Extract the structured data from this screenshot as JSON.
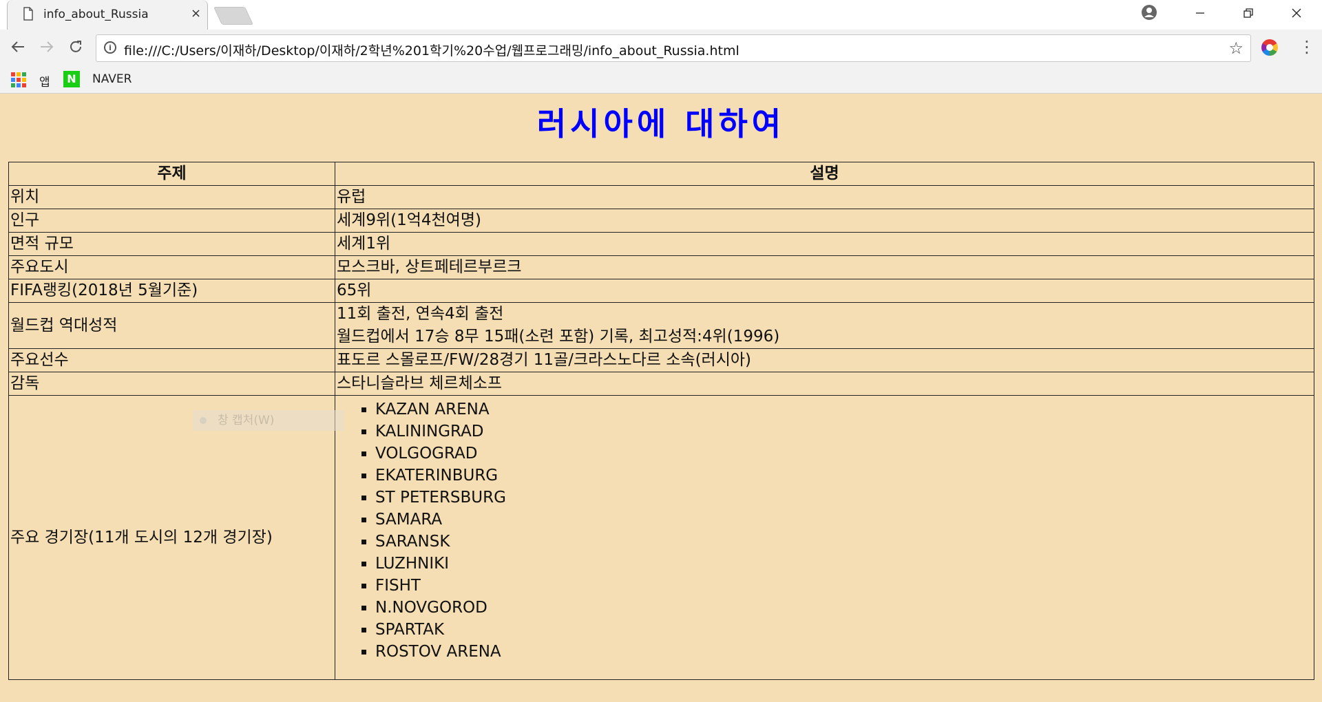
{
  "browser": {
    "tab_title": "info_about_Russia",
    "tab_close": "×",
    "url": "file:///C:/Users/이재하/Desktop/이재하/2학년%201학기%20수업/웹프로그래밍/info_about_Russia.html",
    "bookmarks": {
      "apps_label": "앱",
      "naver_label": "NAVER",
      "naver_icon_letter": "N"
    },
    "colors": {
      "naver": "#19ce15",
      "page_background": "#f5deb3",
      "title": "#0000ff"
    }
  },
  "page": {
    "title": "러시아에 대하여",
    "table": {
      "headers": [
        "주제",
        "설명"
      ],
      "rows": [
        {
          "subject": "위치",
          "lines": [
            "유럽"
          ]
        },
        {
          "subject": "인구",
          "lines": [
            "세계9위(1억4천여명)"
          ]
        },
        {
          "subject": "면적 규모",
          "lines": [
            "세계1위"
          ]
        },
        {
          "subject": "주요도시",
          "lines": [
            "모스크바, 상트페테르부르크"
          ]
        },
        {
          "subject": "FIFA랭킹(2018년 5월기준)",
          "lines": [
            "65위"
          ]
        },
        {
          "subject": "월드컵 역대성적",
          "lines": [
            "11회 출전, 연속4회 출전",
            "월드컵에서 17승 8무 15패(소련 포함) 기록, 최고성적:4위(1996)"
          ]
        },
        {
          "subject": "주요선수",
          "lines": [
            "표도르 스몰로프/FW/28경기 11골/크라스노다르 소속(러시아)"
          ]
        },
        {
          "subject": "감독",
          "lines": [
            "스타니슬라브 체르체소프"
          ]
        }
      ],
      "stadium_row": {
        "subject": "주요 경기장(11개 도시의 12개 경기장)",
        "stadiums": [
          "KAZAN ARENA",
          "KALININGRAD",
          "VOLGOGRAD",
          "EKATERINBURG",
          "ST PETERSBURG",
          "SAMARA",
          "SARANSK",
          "LUZHNIKI",
          "FISHT",
          "N.NOVGOROD",
          "SPARTAK",
          "ROSTOV ARENA"
        ]
      }
    },
    "overlay_hint": "창 캡처(W)"
  }
}
